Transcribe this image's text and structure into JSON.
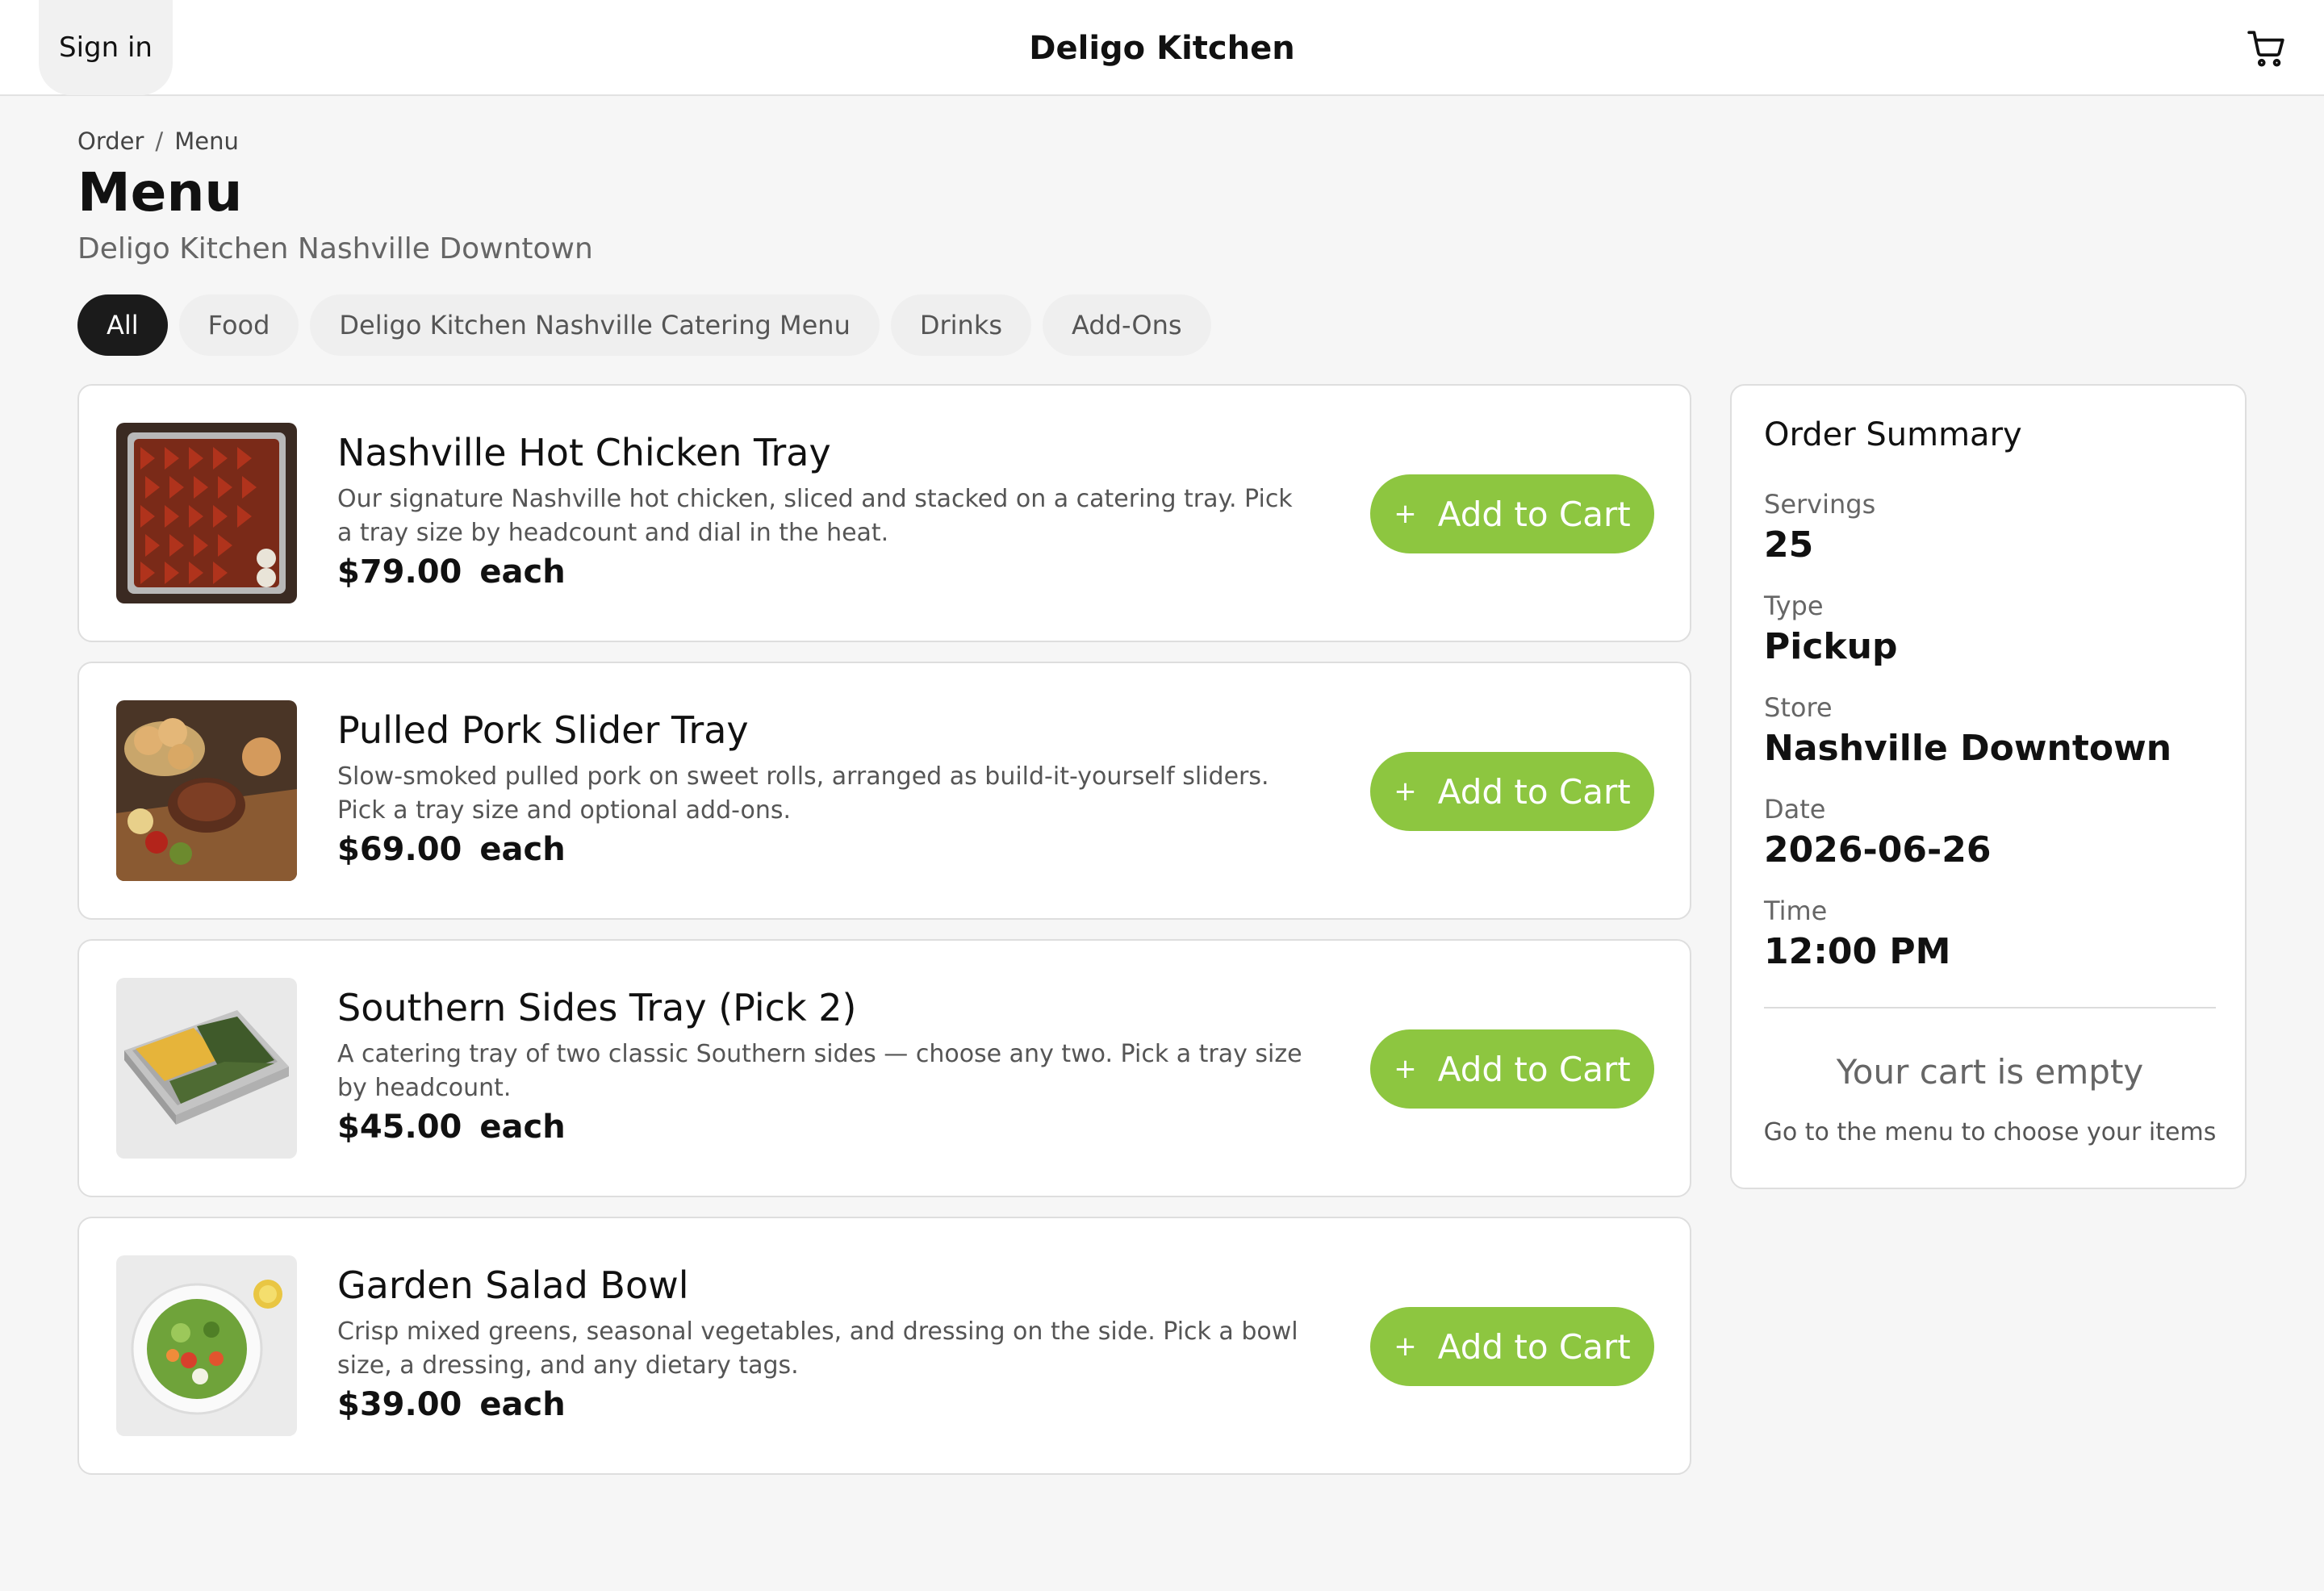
{
  "header": {
    "signin_label": "Sign in",
    "brand": "Deligo Kitchen",
    "cart_icon": "cart-icon"
  },
  "breadcrumb": {
    "items": [
      "Order",
      "Menu"
    ],
    "separator": "/"
  },
  "page": {
    "title": "Menu",
    "subtitle": "Deligo Kitchen Nashville Downtown"
  },
  "tabs": [
    {
      "label": "All",
      "active": true
    },
    {
      "label": "Food",
      "active": false
    },
    {
      "label": "Deligo Kitchen Nashville Catering Menu",
      "active": false
    },
    {
      "label": "Drinks",
      "active": false
    },
    {
      "label": "Add-Ons",
      "active": false
    }
  ],
  "items": [
    {
      "name": "Nashville Hot Chicken Tray",
      "description": "Our signature Nashville hot chicken, sliced and stacked on a catering tray. Pick a tray size by headcount and dial in the heat.",
      "price": "$79.00",
      "unit": "each",
      "button_label": "Add to Cart",
      "button_icon": "+"
    },
    {
      "name": "Pulled Pork Slider Tray",
      "description": "Slow-smoked pulled pork on sweet rolls, arranged as build-it-yourself sliders. Pick a tray size and optional add-ons.",
      "price": "$69.00",
      "unit": "each",
      "button_label": "Add to Cart",
      "button_icon": "+"
    },
    {
      "name": "Southern Sides Tray (Pick 2)",
      "description": "A catering tray of two classic Southern sides — choose any two. Pick a tray size by headcount.",
      "price": "$45.00",
      "unit": "each",
      "button_label": "Add to Cart",
      "button_icon": "+"
    },
    {
      "name": "Garden Salad Bowl",
      "description": "Crisp mixed greens, seasonal vegetables, and dressing on the side. Pick a bowl size, a dressing, and any dietary tags.",
      "price": "$39.00",
      "unit": "each",
      "button_label": "Add to Cart",
      "button_icon": "+"
    }
  ],
  "summary": {
    "title": "Order Summary",
    "servings_label": "Servings",
    "servings_value": "25",
    "type_label": "Type",
    "type_value": "Pickup",
    "store_label": "Store",
    "store_value": "Nashville Downtown",
    "date_label": "Date",
    "date_value": "2026-06-26",
    "time_label": "Time",
    "time_value": "12:00 PM",
    "empty_title": "Your cart is empty",
    "empty_subtitle": "Go to the menu to choose your items"
  },
  "colors": {
    "accent": "#8dc640",
    "active_tab": "#1b1b1b",
    "background": "#f6f6f6"
  }
}
